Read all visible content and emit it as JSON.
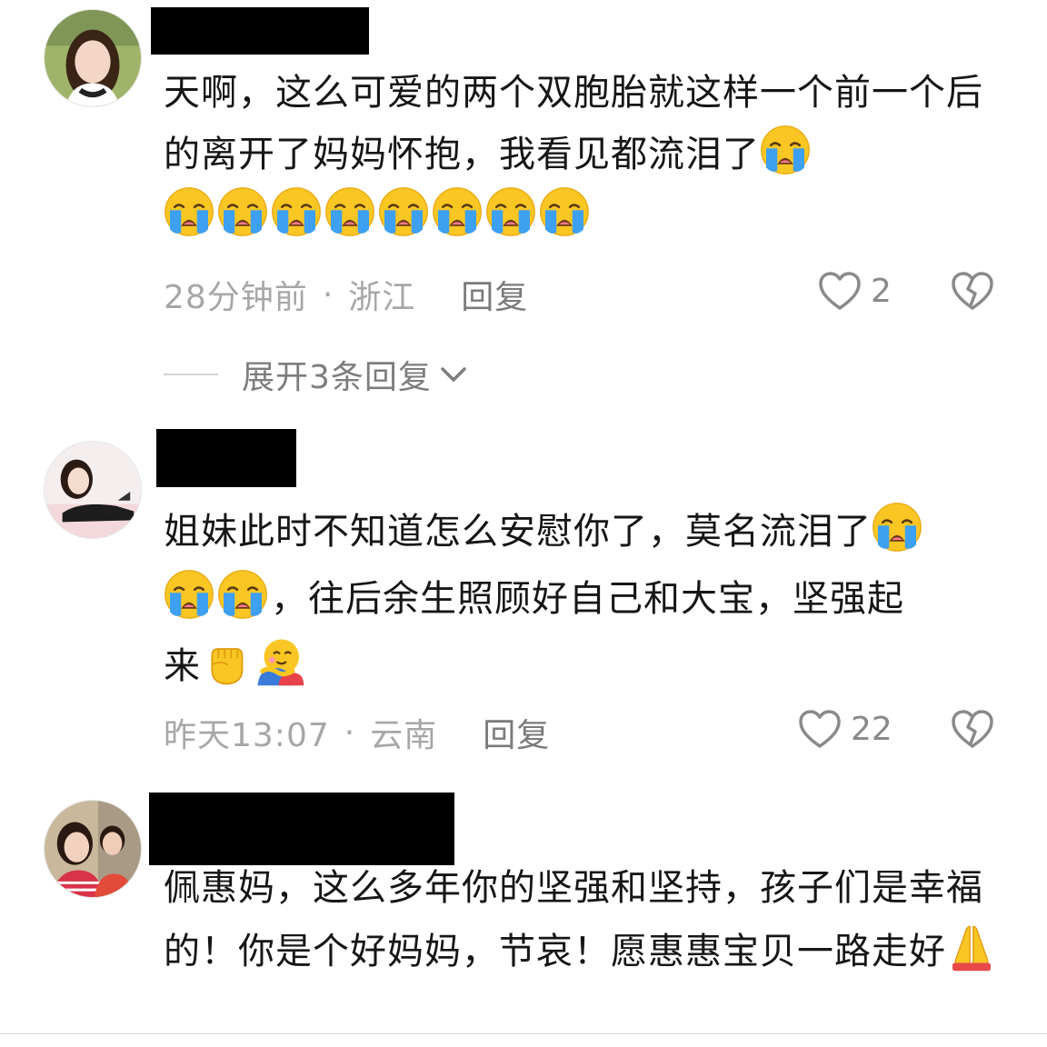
{
  "comments": [
    {
      "text_parts": [
        "天啊，这么可爱的两个双胞胎就这样一个前一个后的离开了妈妈怀抱，我看见都流泪了"
      ],
      "emojis_after": [
        "loudly-crying-face-icon",
        "loudly-crying-face-icon",
        "loudly-crying-face-icon",
        "loudly-crying-face-icon",
        "loudly-crying-face-icon",
        "loudly-crying-face-icon",
        "loudly-crying-face-icon",
        "loudly-crying-face-icon",
        "loudly-crying-face-icon"
      ],
      "time": "28分钟前",
      "location": "浙江",
      "reply_label": "回复",
      "likes": "2",
      "expand_label": "展开3条回复"
    },
    {
      "text_a": "姐妹此时不知道怎么安慰你了，莫名流泪了",
      "text_b": "，往后余生照顾好自己和大宝，坚强起",
      "text_c": "来",
      "time": "昨天13:07",
      "location": "云南",
      "reply_label": "回复",
      "likes": "22"
    },
    {
      "text": "佩惠妈，这么多年你的坚强和坚持，孩子们是幸福的！你是个好妈妈，节哀！愿惠惠宝贝一路走好"
    }
  ],
  "separator": "·",
  "colors": {
    "emoji_face": "#f7c21b",
    "emoji_tear": "#3ea0f0",
    "meta": "#a7a7a7"
  }
}
